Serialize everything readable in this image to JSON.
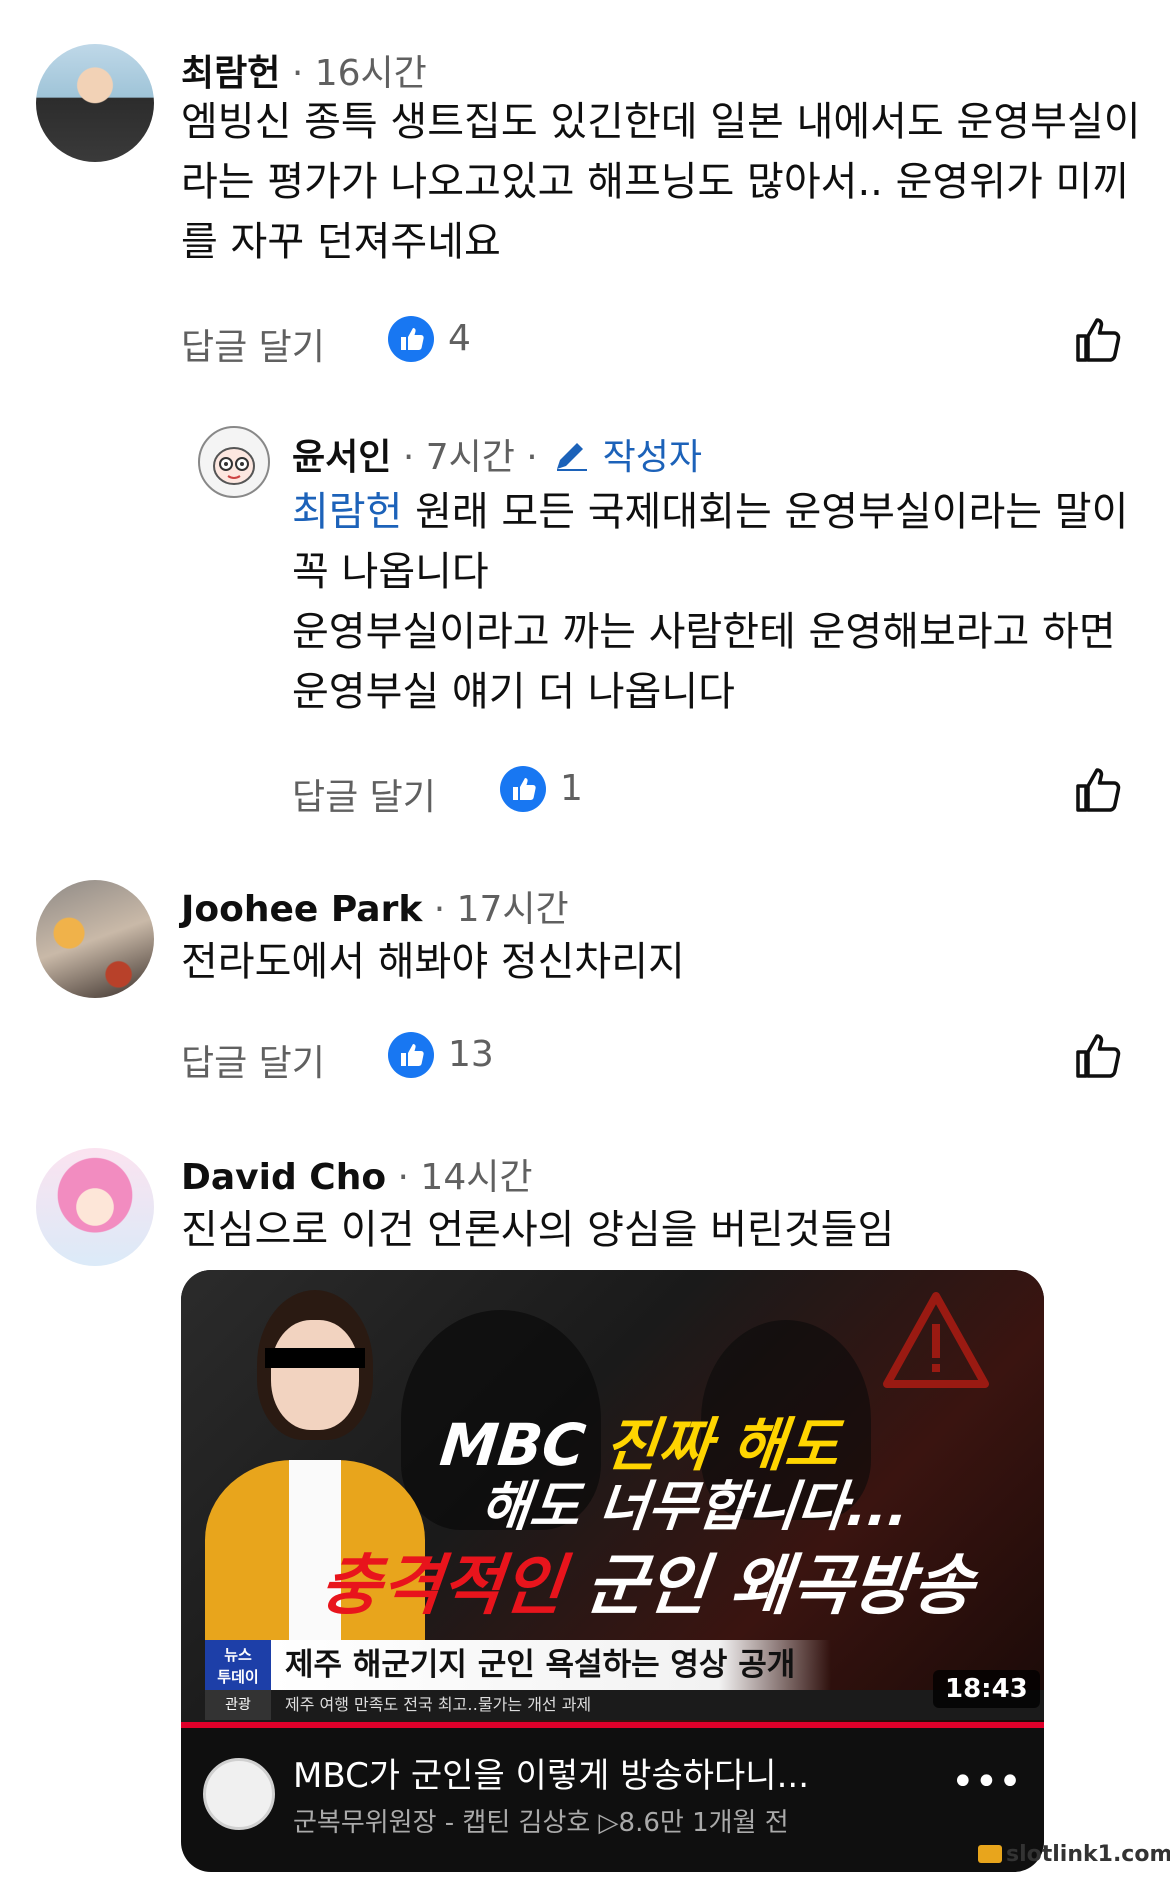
{
  "comments": [
    {
      "author": "최람헌",
      "time": "· 16시간",
      "text": "엠빙신 종특 생트집도 있긴한데 일본 내에서도 운영부실이라는 평가가 나오고있고 해프닝도 많아서..  운영위가 미끼를 자꾸 던져주네요",
      "reply_label": "답글 달기",
      "likes": "4"
    },
    {
      "author": "윤서인",
      "time": "· 7시간 ·",
      "creator_label": "작성자",
      "mention": "최람헌",
      "text_line1": " 원래 모든 국제대회는 운영부실이라는 말이 꼭 나옵니다",
      "text_line2": "운영부실이라고 까는 사람한테 운영해보라고 하면 운영부실 얘기 더 나옵니다",
      "reply_label": "답글 달기",
      "likes": "1"
    },
    {
      "author": "Joohee Park",
      "time": "· 17시간",
      "text": "전라도에서 해봐야 정신차리지",
      "reply_label": "답글 달기",
      "likes": "13"
    },
    {
      "author": "David Cho",
      "time": "· 14시간",
      "text": "진심으로 이건 언론사의 양심을 버린것들임"
    }
  ],
  "video": {
    "headline_1a": "MBC",
    "headline_1b": "진짜 해도",
    "headline_2": "해도 너무합니다...",
    "headline_3a": "충격적인",
    "headline_3b": "군인 왜곡방송",
    "ticker_logo": "뉴스\n투데이",
    "ticker_sub_logo": "관광",
    "ticker_main": "제주 해군기지 군인 욕설하는 영상 공개",
    "ticker_sub": "제주 여행 만족도 전국 최고‥물가는 개선 과제",
    "duration": "18:43",
    "title": "MBC가 군인을 이렇게 방송하다니...",
    "channel_meta": "군복무위원장 - 캡틴 김상호   ▷8.6만   1개월 전",
    "more": "•••"
  },
  "watermark": "slotlink1.com",
  "colors": {
    "like_blue": "#1877f2",
    "mention_blue": "#1c62b9",
    "meta_gray": "#606060",
    "headline_yellow": "#ffd500",
    "headline_red": "#e8141c"
  }
}
